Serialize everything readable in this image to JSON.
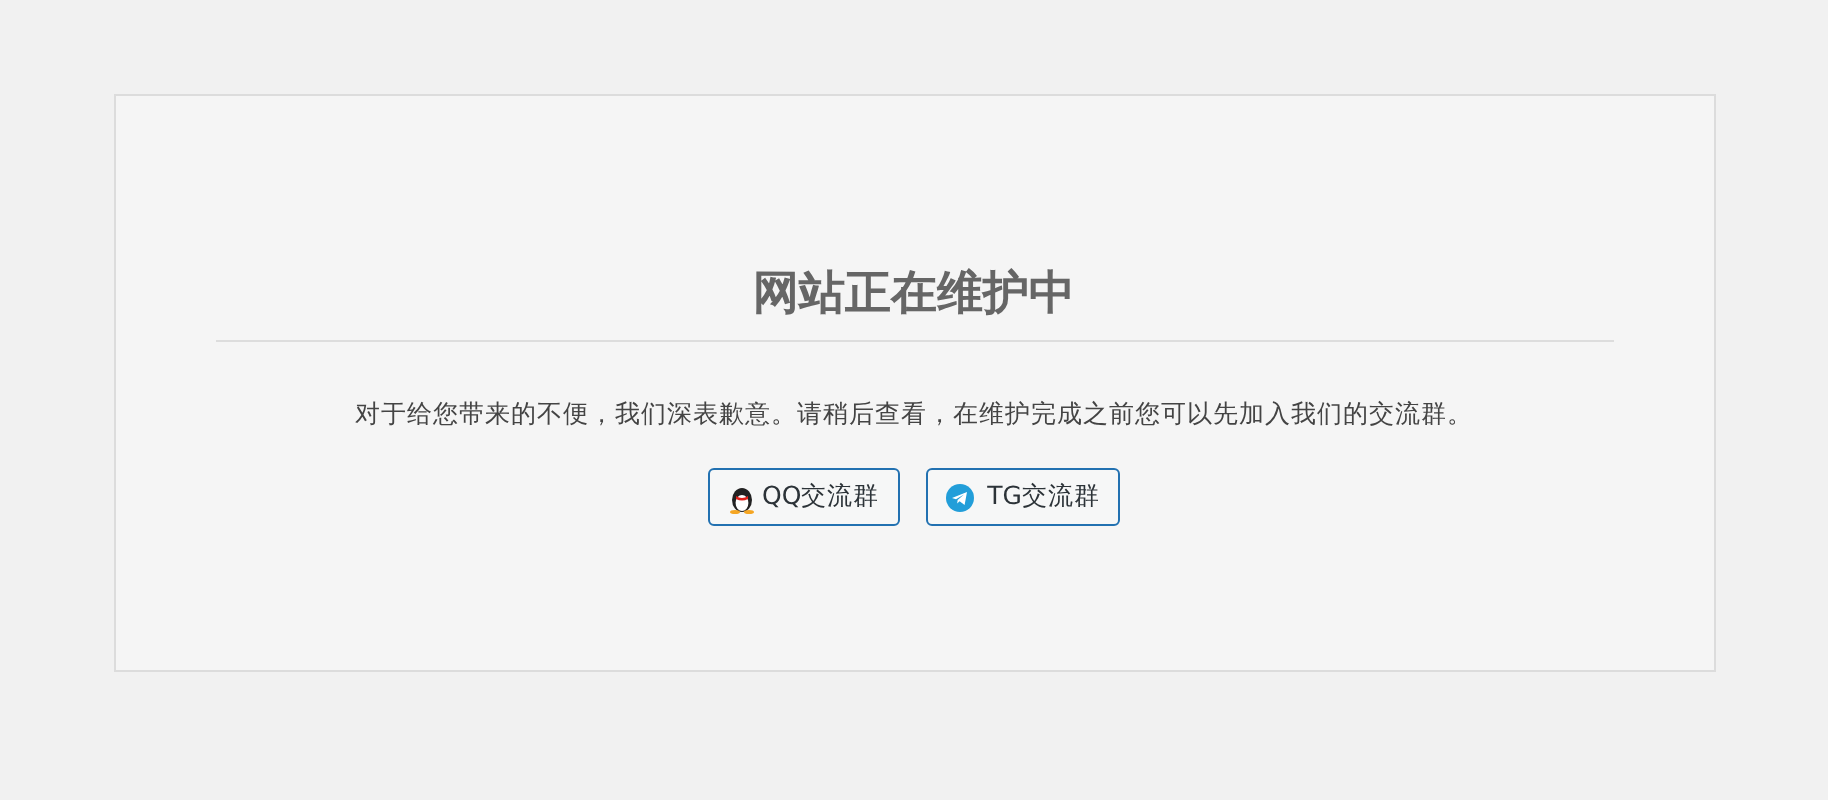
{
  "title": "网站正在维护中",
  "message": "对于给您带来的不便，我们深表歉意。请稍后查看，在维护完成之前您可以先加入我们的交流群。",
  "buttons": [
    {
      "kind": "qq",
      "label": "QQ交流群"
    },
    {
      "kind": "telegram",
      "label": "TG交流群"
    }
  ]
}
